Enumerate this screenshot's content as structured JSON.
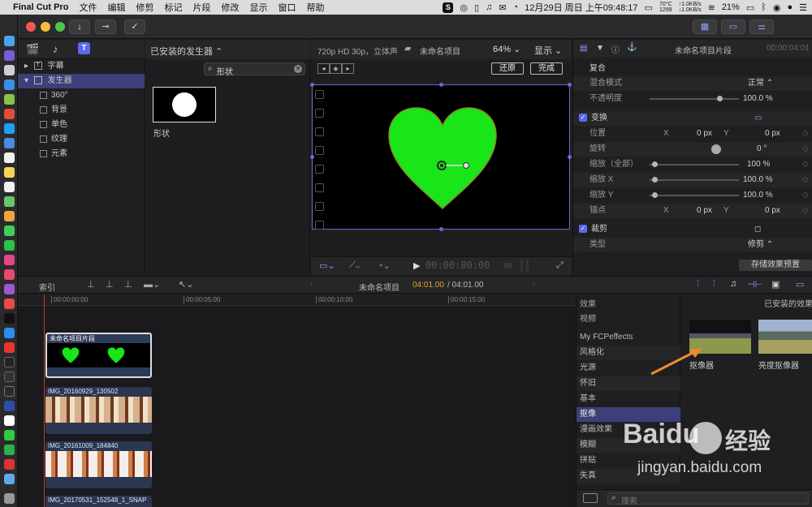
{
  "menubar": {
    "app": "Final Cut Pro",
    "items": [
      "文件",
      "编辑",
      "修剪",
      "标记",
      "片段",
      "修改",
      "显示",
      "窗口",
      "帮助"
    ],
    "temp": "70°C",
    "fan": "1299",
    "up": "↑1.0KB/s",
    "down": "↓1.0KB/s",
    "datetime": "12月29日 周日 上午09:48:17",
    "battery": "21%"
  },
  "browser": {
    "categories": [
      {
        "label": "字幕"
      },
      {
        "label": "发生器"
      }
    ],
    "sub_items": [
      "360°",
      "背景",
      "单色",
      "纹理",
      "元素"
    ],
    "source": "已安装的发生器 ⌃",
    "search_value": "形状",
    "thumb_label": "形状"
  },
  "viewer": {
    "format": "720p HD 30p，立体声",
    "project": "未命名项目",
    "zoom": "64% ⌄",
    "view": "显示 ⌄",
    "reset": "还原",
    "done": "完成",
    "timecode": "00:00:00:00",
    "timecode_frames": "00"
  },
  "inspector": {
    "title": "未命名项目片段",
    "title_tc": "00:00:04:01",
    "composite": {
      "title": "复合",
      "blend_label": "混合模式",
      "blend_value": "正常 ⌃",
      "opacity_label": "不透明度",
      "opacity_value": "100.0 %",
      "opacity_level": 0.78
    },
    "transform": {
      "title": "变换",
      "position": {
        "label": "位置",
        "x_lbl": "X",
        "x": "0 px",
        "y_lbl": "Y",
        "y": "0 px"
      },
      "rotation": {
        "label": "旋转",
        "value": "0 °"
      },
      "scale_all": {
        "label": "缩放（全部）",
        "value": "100 %",
        "level": 0.05
      },
      "scale_x": {
        "label": "缩放 X",
        "value": "100.0 %",
        "level": 0.05
      },
      "scale_y": {
        "label": "缩放 Y",
        "value": "100.0 %",
        "level": 0.05
      },
      "anchor": {
        "label": "锚点",
        "x_lbl": "X",
        "x": "0 px",
        "y_lbl": "Y",
        "y": "0 px"
      }
    },
    "crop": {
      "title": "裁剪",
      "type_label": "类型",
      "type_value": "修剪 ⌃"
    },
    "save_preset": "存储效果预置"
  },
  "timeline": {
    "index": "索引",
    "project": "未命名项目",
    "duration_current": "04:01.00",
    "duration_total": "/ 04:01.00",
    "ruler": [
      "00:00:00:00",
      "00:00:05:00",
      "00:00:10:00",
      "00:00:15:00"
    ],
    "clips": [
      {
        "name": "未命名项目片段"
      },
      {
        "name": "IMG_20160929_130502"
      },
      {
        "name": "IMG_20161009_184840"
      },
      {
        "name": "IMG_20170531_152548_1_SNAP"
      }
    ]
  },
  "effects": {
    "header": "效果",
    "section": "视频",
    "categories": [
      "My FCPeffects",
      "风格化",
      "光源",
      "怀旧",
      "基本",
      "抠像",
      "漫画效果",
      "模糊",
      "拼贴",
      "失真"
    ],
    "selected": "抠像",
    "installed": "已安装的效果",
    "items": [
      {
        "label": "抠像器"
      },
      {
        "label": "亮度抠像器"
      }
    ],
    "search_placeholder": "搜索"
  },
  "watermark": {
    "logo": "Baidu",
    "logo_cn": "经验",
    "url": "jingyan.baidu.com"
  },
  "colors": {
    "accent": "#5a6af0",
    "selection": "#3d3f78",
    "heart": "#19e619",
    "timecode": "#e0a820",
    "arrow": "#f08a2a"
  }
}
